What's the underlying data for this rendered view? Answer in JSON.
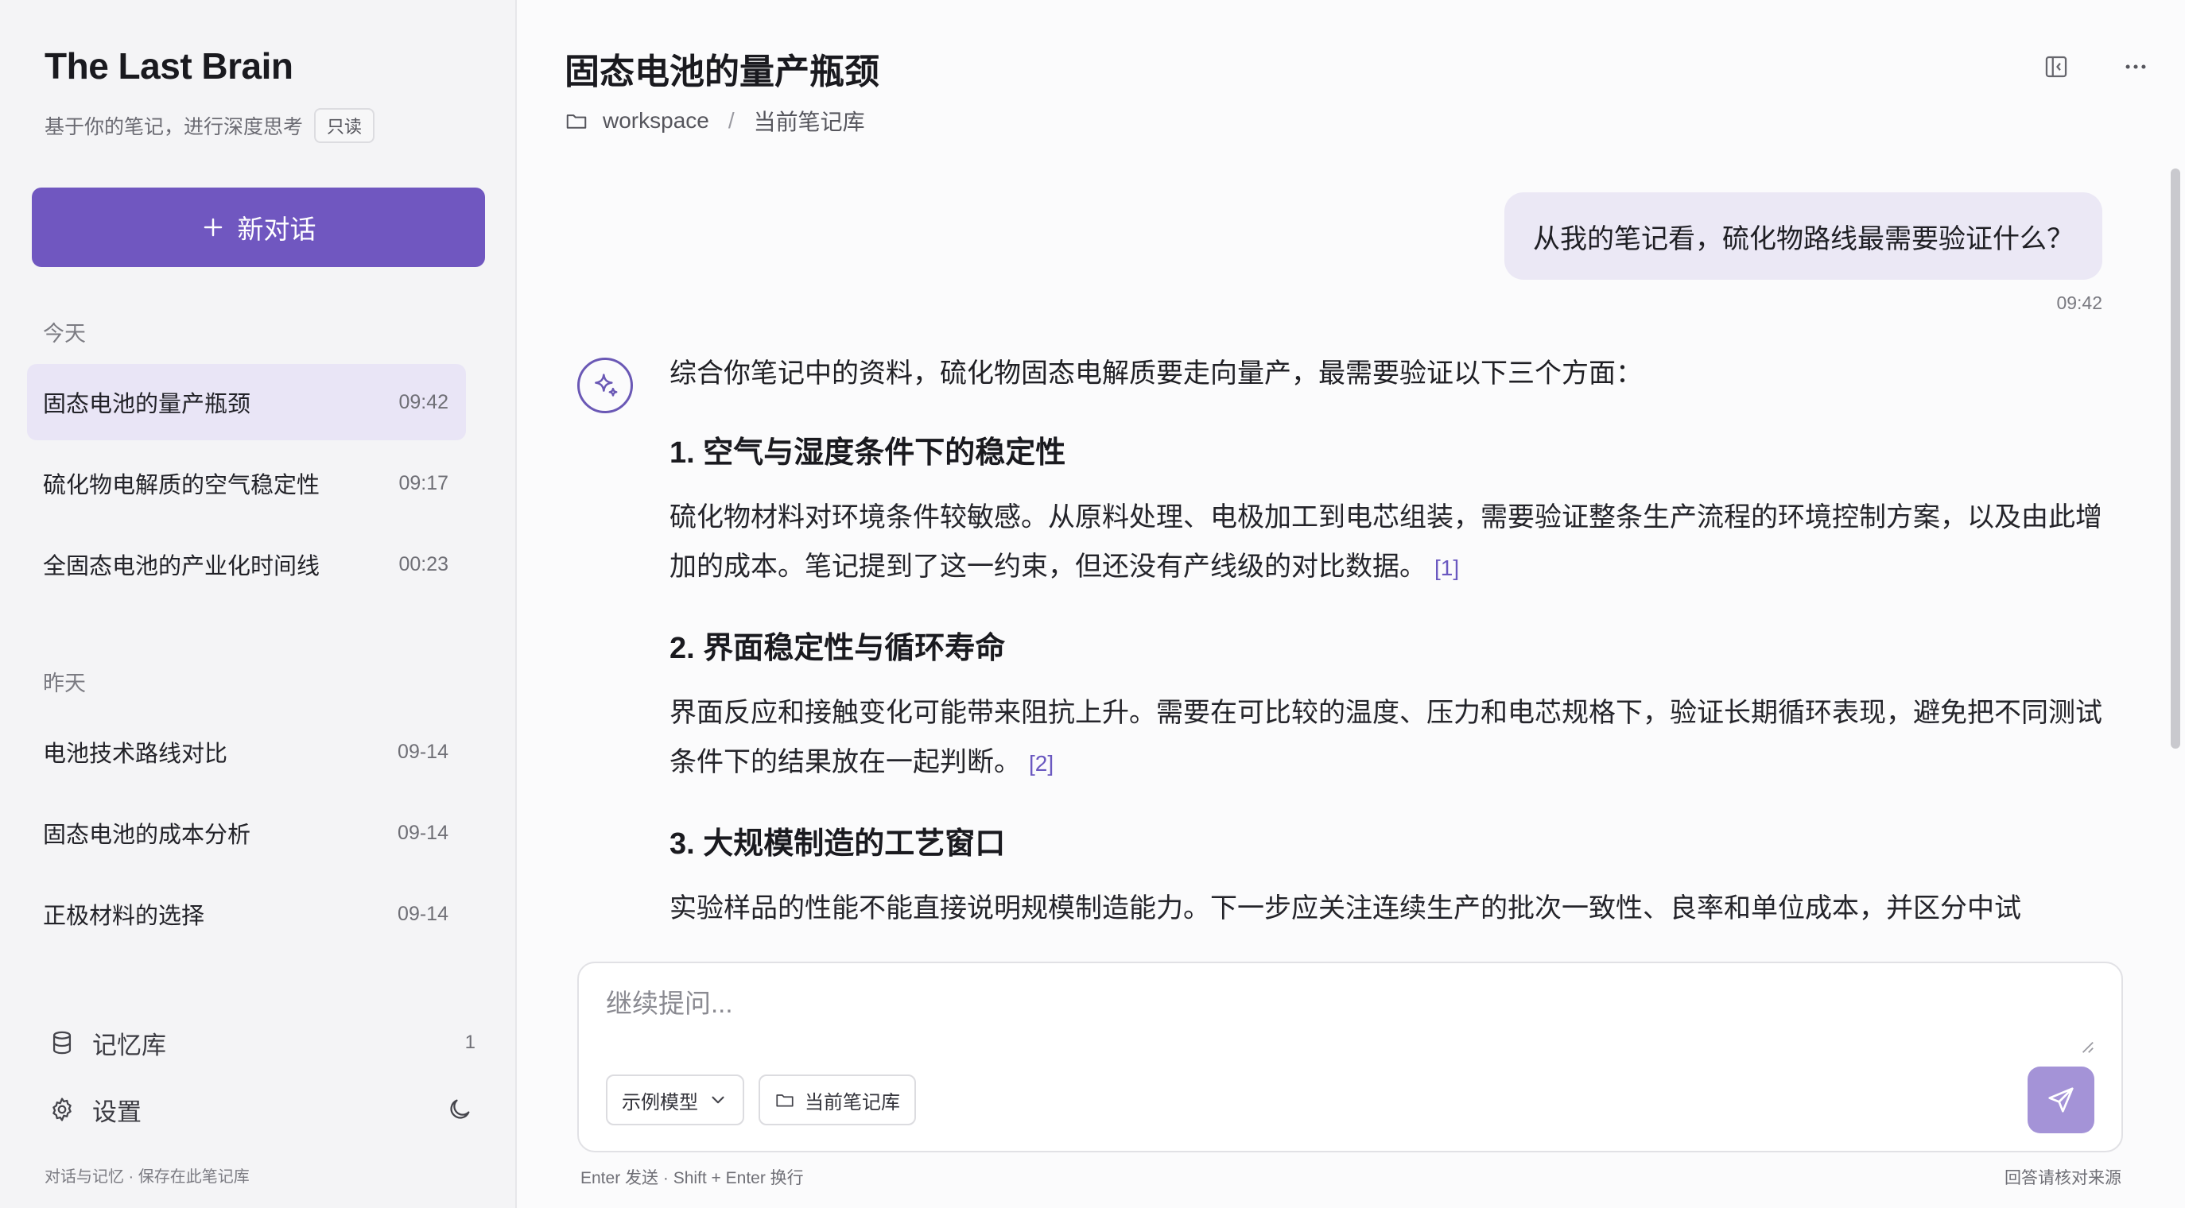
{
  "sidebar": {
    "app_title": "The Last Brain",
    "subtitle": "基于你的笔记，进行深度思考",
    "readonly_badge": "只读",
    "new_chat_label": "新对话",
    "sections": [
      {
        "label": "今天",
        "items": [
          {
            "title": "固态电池的量产瓶颈",
            "time": "09:42",
            "active": true
          },
          {
            "title": "硫化物电解质的空气稳定性",
            "time": "09:17"
          },
          {
            "title": "全固态电池的产业化时间线",
            "time": "00:23"
          }
        ]
      },
      {
        "label": "昨天",
        "items": [
          {
            "title": "电池技术路线对比",
            "time": "09-14"
          },
          {
            "title": "固态电池的成本分析",
            "time": "09-14"
          },
          {
            "title": "正极材料的选择",
            "time": "09-14"
          }
        ]
      }
    ],
    "memory_label": "记忆库",
    "memory_count": "1",
    "settings_label": "设置",
    "footer_note": "对话与记忆 · 保存在此笔记库"
  },
  "main": {
    "title": "固态电池的量产瓶颈",
    "breadcrumb": [
      "workspace",
      "/",
      "当前笔记库"
    ],
    "user_message": "从我的笔记看，硫化物路线最需要验证什么？",
    "user_time": "09:42",
    "answer": {
      "intro": "综合你笔记中的资料，硫化物固态电解质要走向量产，最需要验证以下三个方面：",
      "points": [
        {
          "heading": "1. 空气与湿度条件下的稳定性",
          "body": "硫化物材料对环境条件较敏感。从原料处理、电极加工到电芯组装，需要验证整条生产流程的环境控制方案，以及由此增加的成本。笔记提到了这一约束，但还没有产线级的对比数据。",
          "cite": "[1]"
        },
        {
          "heading": "2. 界面稳定性与循环寿命",
          "body": "界面反应和接触变化可能带来阻抗上升。需要在可比较的温度、压力和电芯规格下，验证长期循环表现，避免把不同测试条件下的结果放在一起判断。",
          "cite": "[2]"
        },
        {
          "heading": "3. 大规模制造的工艺窗口",
          "body": "实验样品的性能不能直接说明规模制造能力。下一步应关注连续生产的批次一致性、良率和单位成本，并区分中试",
          "cite": ""
        }
      ]
    },
    "composer": {
      "placeholder": "继续提问...",
      "model_label": "示例模型",
      "scope_label": "当前笔记库",
      "hint_left": "Enter 发送 · Shift + Enter 换行",
      "hint_right": "回答请核对来源"
    }
  },
  "colors": {
    "accent": "#7057c0",
    "active_item_bg": "#e9e5f6",
    "user_bubble_bg": "#ebe8f5",
    "citation": "#6a58c0",
    "send_button": "#a493d7"
  },
  "icons": {
    "new_chat": "plus-icon",
    "breadcrumb": "folder-icon",
    "panel_toggle": "sidebar-collapse-icon",
    "more": "more-horizontal-icon",
    "assistant": "sparkle-icon",
    "memory": "database-icon",
    "settings": "gear-icon",
    "theme": "moon-icon",
    "model_dropdown": "chevron-down-icon",
    "scope": "folder-icon",
    "send": "send-icon"
  }
}
